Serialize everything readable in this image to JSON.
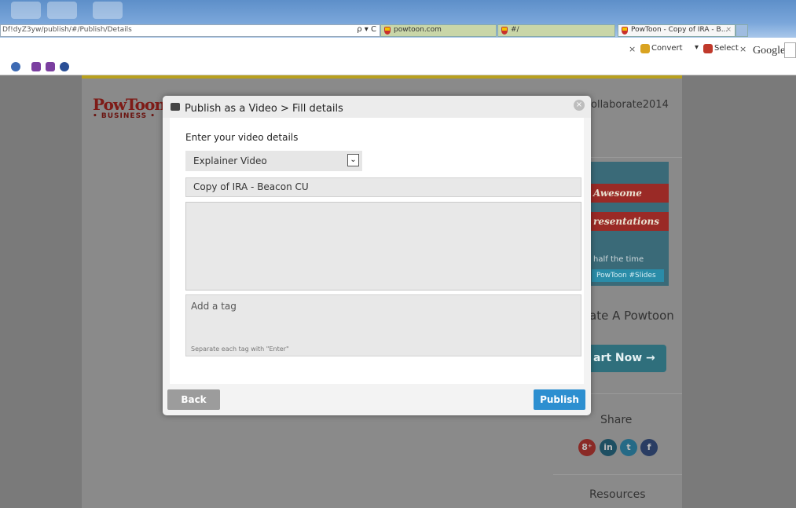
{
  "browser": {
    "url": "Df!dyZ3yw/publish/#/Publish/Details",
    "address_controls": "ρ ▾ C",
    "tabs": [
      {
        "label": "powtoon.com"
      },
      {
        "label": "#/"
      },
      {
        "label": "PowToon - Copy of IRA - B..."
      }
    ],
    "tab_close": "×",
    "toolbar": {
      "convert_label": "Convert",
      "select_label": "Select",
      "close_glyph": "×",
      "google_label": "Google",
      "dropdown_glyph": "▾"
    }
  },
  "site": {
    "logo_text": "PowToon",
    "logo_sub": "• BUSINESS •",
    "username": "ollaborate2014",
    "promo": {
      "line1": "Awesome",
      "line2": "resentations",
      "line3": "half the time",
      "tag": "PowToon #Slides"
    },
    "create_text": "ate A Powtoon",
    "start_label": "art Now →",
    "share_label": "Share",
    "social": {
      "gplus": "8⁺",
      "linkedin": "in",
      "twitter": "t",
      "facebook": "f"
    },
    "resources_label": "Resources"
  },
  "modal": {
    "title": "Publish as a Video > Fill details",
    "close_glyph": "×",
    "heading": "Enter your video details",
    "category": {
      "selected": "Explainer Video",
      "arrow": "⌄"
    },
    "video_title": "Copy of IRA - Beacon CU",
    "description": "",
    "tags": {
      "placeholder": "Add a tag",
      "hint": "Separate each tag with \"Enter\""
    },
    "back_label": "Back",
    "publish_label": "Publish"
  }
}
